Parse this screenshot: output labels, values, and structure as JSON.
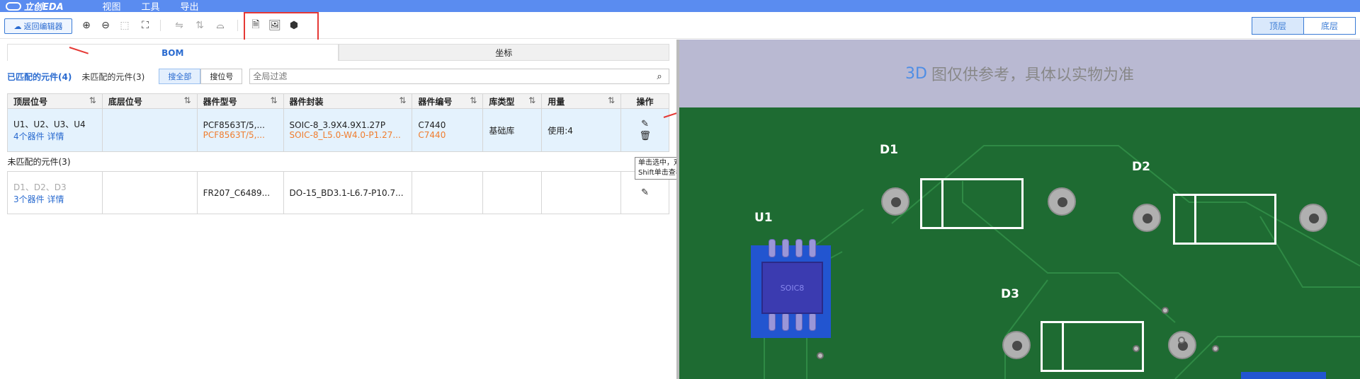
{
  "menu": {
    "logo": "立创EDA",
    "items": [
      "视图",
      "工具",
      "导出"
    ]
  },
  "toolbar": {
    "back_label": "返回编辑器",
    "icons": [
      "zoom-in",
      "zoom-out",
      "fit-selection",
      "fit-all",
      "flip-horizontal",
      "flip-vertical",
      "reset-view",
      "export-bom",
      "export-image",
      "export-3d"
    ],
    "view_top": "顶层",
    "view_bottom": "底层"
  },
  "tabs": [
    "BOM",
    "坐标"
  ],
  "filter": {
    "matched": "已匹配的元件(4)",
    "unmatched": "未匹配的元件(3)",
    "search_all": "搜全部",
    "search_designator": "搜位号",
    "placeholder": "全局过滤"
  },
  "columns": [
    "顶层位号",
    "底层位号",
    "器件型号",
    "器件封装",
    "器件编号",
    "库类型",
    "用量",
    "操作"
  ],
  "sort_glyph": "⇅",
  "rows": {
    "matched": {
      "top": "U1、U2、U3、U4",
      "count_link": "4个器件",
      "detail_link": "详情",
      "bottom": "",
      "model": "PCF8563T/5,...",
      "model_alt": "PCF8563T/5,...",
      "package": "SOIC-8_3.9X4.9X1.27P",
      "package_alt": "SOIC-8_L5.0-W4.0-P1.27...",
      "part_no": "C7440",
      "part_no_alt": "C7440",
      "lib_type": "基础库",
      "usage": "使用:4"
    },
    "unmatched_label": "未匹配的元件(3)",
    "unmatched": {
      "top": "D1、D2、D3",
      "count_link": "3个器件",
      "detail_link": "详情",
      "model": "FR207_C6489...",
      "package": "DO-15_BD3.1-L6.7-P10.7..."
    }
  },
  "tooltip": {
    "line1": "单击选中，双击定位",
    "line2": "Shift单击查看数据手册"
  },
  "viewer": {
    "banner_3d": "3D",
    "banner_text": "图仅供参考，具体以实物为准",
    "labels": {
      "u1": "U1",
      "d1": "D1",
      "d2": "D2",
      "d3": "D3"
    },
    "chip_text": "SOIC8",
    "board_color": "#1e6b32",
    "silk_color": "#ffffff"
  },
  "colors": {
    "menubar": "#5a8cf0",
    "accent": "#2a6bd0",
    "orange": "#f07d2e",
    "annotation_red": "#e53935"
  }
}
